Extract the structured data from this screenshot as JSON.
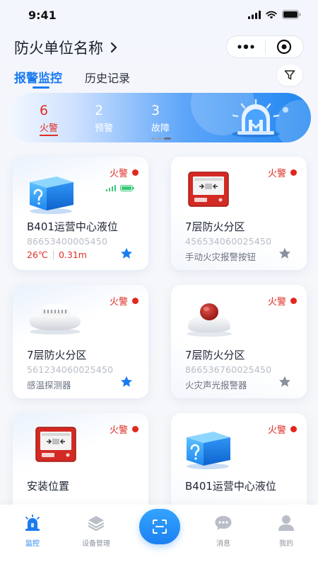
{
  "status_bar": {
    "time": "9:41"
  },
  "header": {
    "org_name": "防火单位名称"
  },
  "tabs": [
    {
      "label": "报警监控",
      "active": true
    },
    {
      "label": "历史记录",
      "active": false
    }
  ],
  "banner": {
    "stats": [
      {
        "value": "6",
        "label": "火警"
      },
      {
        "value": "2",
        "label": "预警"
      },
      {
        "value": "3",
        "label": "故障"
      }
    ]
  },
  "cards": [
    {
      "status": "火警",
      "title": "B401运营中心液位",
      "code": "86653400005450",
      "reading_temp": "26℃",
      "reading_level": "0.31m",
      "starred": true,
      "icon": "cube-unknown-icon"
    },
    {
      "status": "火警",
      "title": "7层防火分区",
      "code": "456534060025450",
      "desc": "手动火灾报警按钮",
      "starred": false,
      "icon": "manual-alarm-button-icon"
    },
    {
      "status": "火警",
      "title": "7层防火分区",
      "code": "561234060025450",
      "desc": "感温探测器",
      "starred": true,
      "icon": "heat-detector-icon"
    },
    {
      "status": "火警",
      "title": "7层防火分区",
      "code": "866536760025450",
      "desc": "火灾声光报警器",
      "starred": false,
      "icon": "strobe-siren-icon"
    },
    {
      "status": "火警",
      "title": "安装位置",
      "icon": "manual-alarm-button-icon"
    },
    {
      "status": "火警",
      "title": "B401运营中心液位",
      "icon": "cube-unknown-icon"
    }
  ],
  "bottom_nav": [
    {
      "label": "监控",
      "icon": "alarm-light-icon",
      "active": true
    },
    {
      "label": "设备管理",
      "icon": "layers-icon",
      "active": false
    },
    {
      "label": "",
      "icon": "scan-icon",
      "active": false
    },
    {
      "label": "消息",
      "icon": "chat-bubble-icon",
      "active": false
    },
    {
      "label": "我的",
      "icon": "user-icon",
      "active": false
    }
  ],
  "colors": {
    "accent": "#1b7bf0",
    "alarm": "#e02e24",
    "star_active": "#1b7bf0",
    "star_inactive": "#8a919c"
  }
}
